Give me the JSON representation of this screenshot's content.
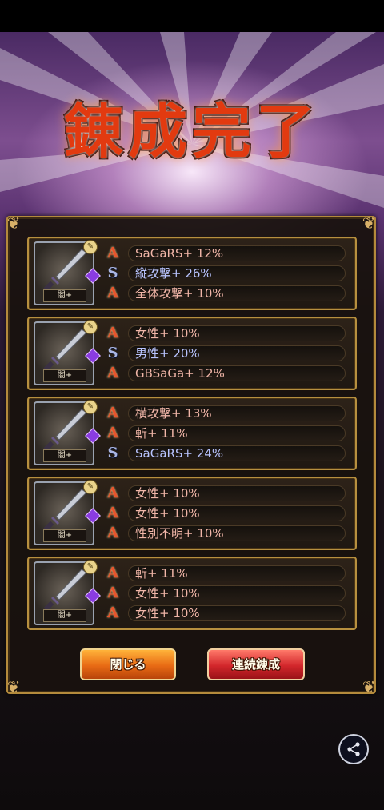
{
  "title": "錬成完了",
  "cards": [
    {
      "badge": "闇+",
      "rows": [
        {
          "rank": "A",
          "rank_type": "a",
          "text": "SaGaRS+ 12%",
          "color": "red"
        },
        {
          "rank": "S",
          "rank_type": "s",
          "text": "縦攻撃+ 26%",
          "color": "blue"
        },
        {
          "rank": "A",
          "rank_type": "a",
          "text": "全体攻撃+ 10%",
          "color": "red"
        }
      ]
    },
    {
      "badge": "闇+",
      "rows": [
        {
          "rank": "A",
          "rank_type": "a",
          "text": "女性+ 10%",
          "color": "red"
        },
        {
          "rank": "S",
          "rank_type": "s",
          "text": "男性+ 20%",
          "color": "blue"
        },
        {
          "rank": "A",
          "rank_type": "a",
          "text": "GBSaGa+ 12%",
          "color": "red"
        }
      ]
    },
    {
      "badge": "闇+",
      "rows": [
        {
          "rank": "A",
          "rank_type": "a",
          "text": "横攻撃+ 13%",
          "color": "red"
        },
        {
          "rank": "A",
          "rank_type": "a",
          "text": "斬+ 11%",
          "color": "red"
        },
        {
          "rank": "S",
          "rank_type": "s",
          "text": "SaGaRS+ 24%",
          "color": "blue"
        }
      ]
    },
    {
      "badge": "闇+",
      "rows": [
        {
          "rank": "A",
          "rank_type": "a",
          "text": "女性+ 10%",
          "color": "red"
        },
        {
          "rank": "A",
          "rank_type": "a",
          "text": "女性+ 10%",
          "color": "red"
        },
        {
          "rank": "A",
          "rank_type": "a",
          "text": "性別不明+ 10%",
          "color": "red"
        }
      ]
    },
    {
      "badge": "闇+",
      "rows": [
        {
          "rank": "A",
          "rank_type": "a",
          "text": "斬+ 11%",
          "color": "red"
        },
        {
          "rank": "A",
          "rank_type": "a",
          "text": "女性+ 10%",
          "color": "red"
        },
        {
          "rank": "A",
          "rank_type": "a",
          "text": "女性+ 10%",
          "color": "red"
        }
      ]
    }
  ],
  "buttons": {
    "close_label": "閉じる",
    "continue_label": "連続錬成"
  },
  "icons": {
    "share": "share-icon",
    "weapon": "sword-icon",
    "rank_a": "rank-a-icon",
    "rank_s": "rank-s-icon"
  },
  "colors": {
    "title": "#e23a10",
    "frame_gold": "#b7903f",
    "rank_a": "#e8542c",
    "rank_s": "#a9b6e6",
    "text_red": "#f1b6a8",
    "text_blue": "#b9c4ff",
    "close_button": "#e86a14",
    "continue_button": "#d2262b"
  }
}
